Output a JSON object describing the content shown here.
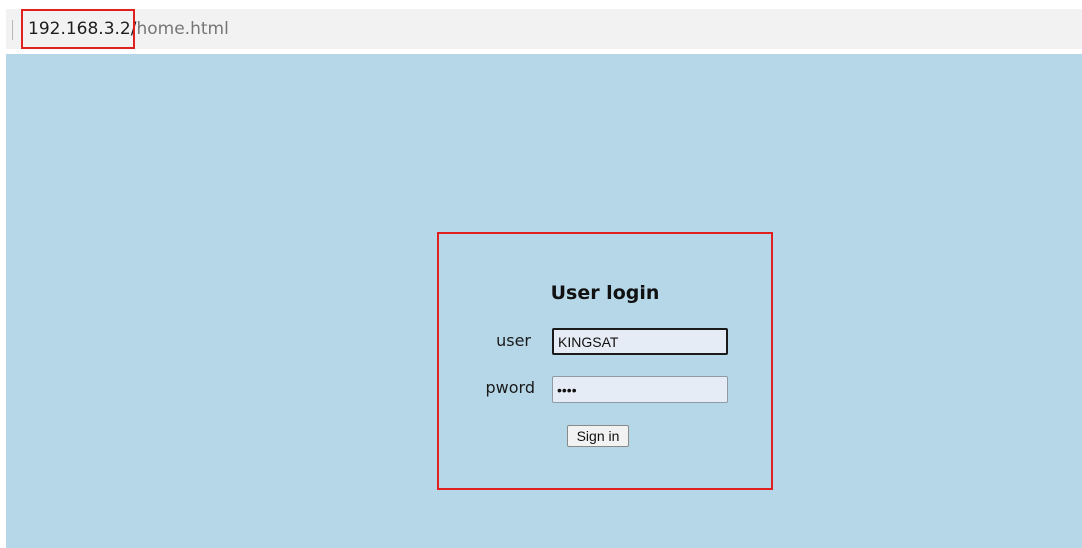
{
  "address_bar": {
    "host": "192.168.3.2/",
    "path": "home.html",
    "highlight_color": "#e0201f"
  },
  "page": {
    "background_color": "#b5d7e8"
  },
  "login": {
    "title": "User login",
    "user_label": "user",
    "user_value": "KINGSAT",
    "pword_label": "pword",
    "pword_value": "••••",
    "signin_label": "Sign in",
    "highlight_color": "#e0201f"
  }
}
